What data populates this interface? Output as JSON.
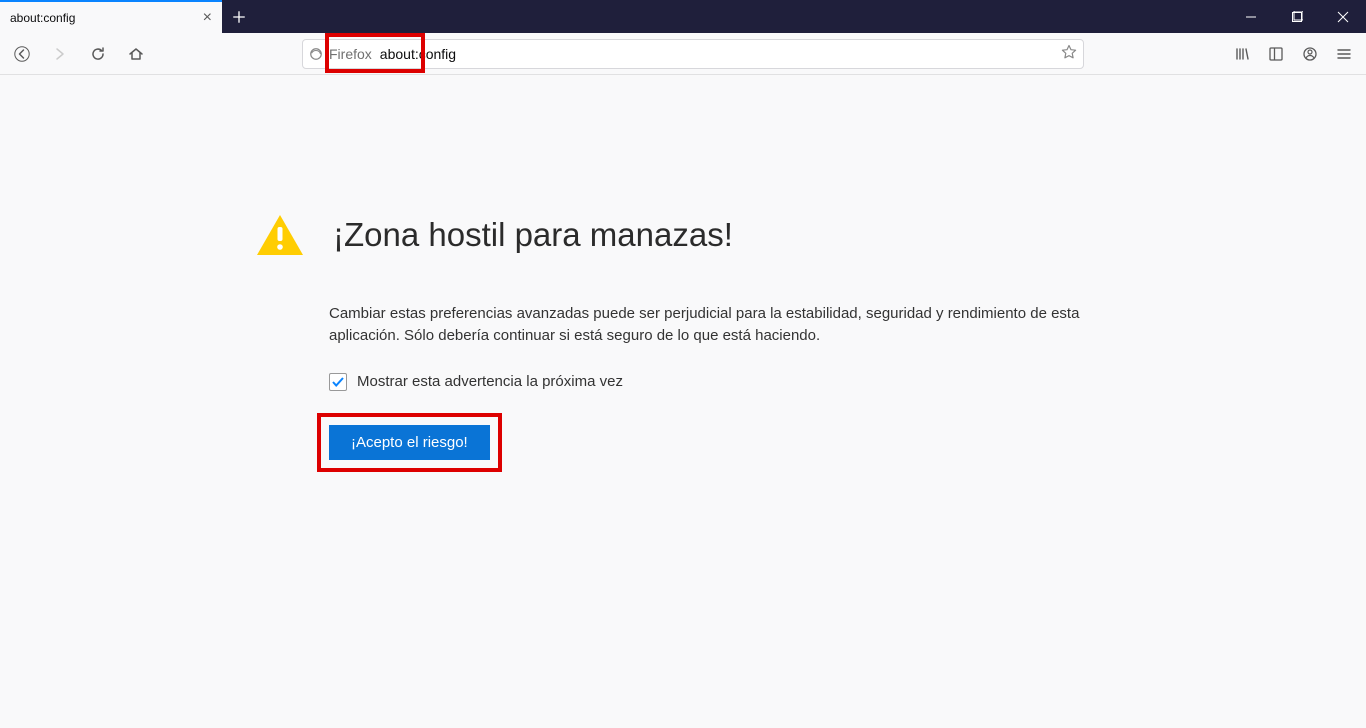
{
  "tab": {
    "title": "about:config"
  },
  "urlbar": {
    "identity_label": "Firefox",
    "url": "about:config"
  },
  "warning": {
    "title": "¡Zona hostil para manazas!",
    "description": "Cambiar estas preferencias avanzadas puede ser perjudicial para la estabilidad, seguridad y rendimiento de esta aplicación. Sólo debería continuar si está seguro de lo que está haciendo.",
    "checkbox_label": "Mostrar esta advertencia la próxima vez",
    "checkbox_checked": true,
    "accept_label": "¡Acepto el riesgo!"
  }
}
